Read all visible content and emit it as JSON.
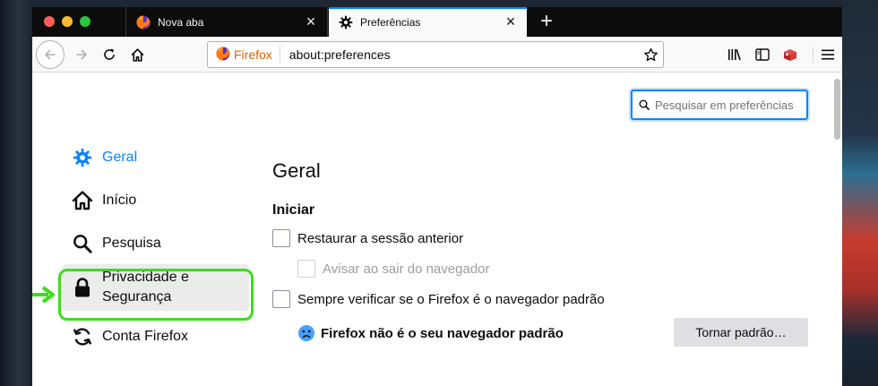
{
  "tabs": [
    {
      "label": "Nova aba",
      "icon": "firefox-logo-icon",
      "active": false
    },
    {
      "label": "Preferências",
      "icon": "gear-icon",
      "active": true
    }
  ],
  "navbar": {
    "identity_label": "Firefox",
    "url": "about:preferences"
  },
  "search": {
    "placeholder": "Pesquisar em preferências"
  },
  "sidebar": {
    "items": [
      {
        "label": "Geral",
        "icon": "gear-icon",
        "selected": true
      },
      {
        "label": "Início",
        "icon": "home-icon",
        "selected": false
      },
      {
        "label": "Pesquisa",
        "icon": "search-icon",
        "selected": false
      },
      {
        "label_line1": "Privacidade e",
        "label_line2": "Segurança",
        "icon": "lock-icon",
        "highlighted": true
      },
      {
        "label": "Conta Firefox",
        "icon": "sync-icon",
        "selected": false
      }
    ]
  },
  "main": {
    "heading": "Geral",
    "section_title": "Iniciar",
    "restore_session_label": "Restaurar a sessão anterior",
    "warn_on_quit_label": "Avisar ao sair do navegador",
    "always_check_default_label": "Sempre verificar se o Firefox é o navegador padrão",
    "not_default_status": "Firefox não é o seu navegador padrão",
    "make_default_button": "Tornar padrão…"
  },
  "colors": {
    "accent": "#0a84ff",
    "highlight_frame": "#3cdd1c",
    "tab_strip": "#0c0c0d"
  }
}
